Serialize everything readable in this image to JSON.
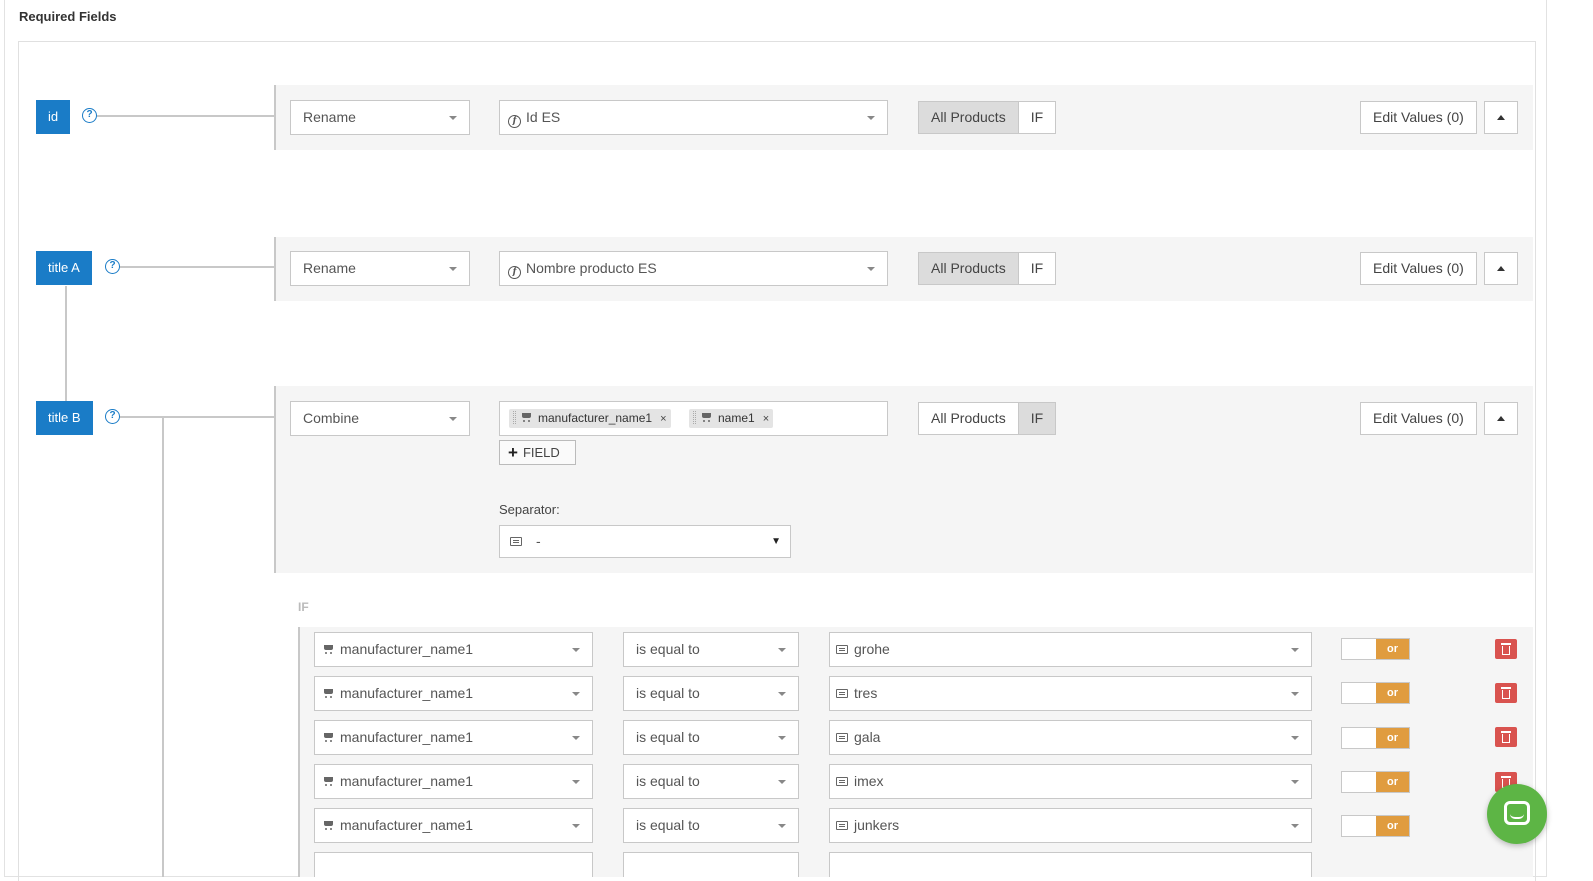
{
  "section_title": "Required Fields",
  "help_glyph": "?",
  "fields": [
    {
      "tag": "id",
      "operation": "Rename",
      "source": "Id ES",
      "scope_all": "All Products",
      "scope_if": "IF",
      "active_scope": "All Products",
      "edit_values": "Edit Values (0)"
    },
    {
      "tag": "title A",
      "operation": "Rename",
      "source": "Nombre producto ES",
      "scope_all": "All Products",
      "scope_if": "IF",
      "active_scope": "All Products",
      "edit_values": "Edit Values (0)"
    },
    {
      "tag": "title B",
      "operation": "Combine",
      "chips": [
        "manufacturer_name1",
        "name1"
      ],
      "add_field": "FIELD",
      "separator_label": "Separator:",
      "separator_value": "-",
      "scope_all": "All Products",
      "scope_if": "IF",
      "active_scope": "IF",
      "edit_values": "Edit Values (0)"
    }
  ],
  "chip_remove_glyph": "×",
  "if_label": "IF",
  "conditions": [
    {
      "field": "manufacturer_name1",
      "operator": "is equal to",
      "value": "grohe",
      "logic": "or"
    },
    {
      "field": "manufacturer_name1",
      "operator": "is equal to",
      "value": "tres",
      "logic": "or"
    },
    {
      "field": "manufacturer_name1",
      "operator": "is equal to",
      "value": "gala",
      "logic": "or"
    },
    {
      "field": "manufacturer_name1",
      "operator": "is equal to",
      "value": "imex",
      "logic": "or"
    },
    {
      "field": "manufacturer_name1",
      "operator": "is equal to",
      "value": "junkers",
      "logic": "or"
    }
  ],
  "colors": {
    "tag_blue": "#1a7cc7",
    "toggle_orange": "#e09c3f",
    "delete_red": "#d9534f",
    "chat_green": "#5db545"
  },
  "icons": {
    "source_icon": "function-icon",
    "chip_icon": "cart-icon",
    "value_icon": "keyboard-icon",
    "delete_icon": "trash-icon",
    "chat_icon": "chat-icon"
  }
}
